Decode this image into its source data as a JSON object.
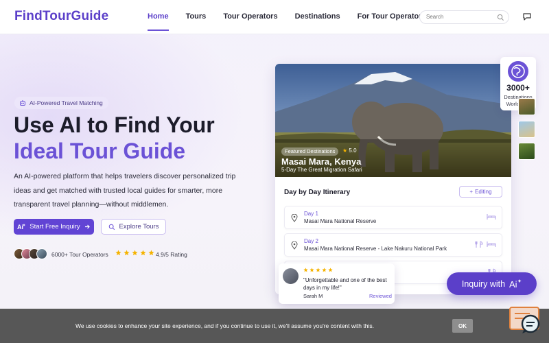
{
  "header": {
    "logo": "FindTourGuide",
    "nav": [
      "Home",
      "Tours",
      "Tour Operators",
      "Destinations",
      "For Tour Operators"
    ],
    "active_nav": "Home",
    "search_placeholder": "Search"
  },
  "hero": {
    "badge": "AI-Powered Travel Matching",
    "title_line1": "Use AI to Find Your",
    "title_line2": "Ideal Tour Guide",
    "description": "An AI-powered platform that helps travelers discover personalized trip ideas and get matched with trusted local guides for smarter, more transparent travel planning—without middlemen.",
    "primary_button": "Start Free Inquiry",
    "secondary_button": "Explore Tours",
    "operators": "6000+ Tour Operators",
    "rating": "4.9/5 Rating"
  },
  "card": {
    "tag": "Featured Destinations",
    "rating": "5.0",
    "title": "Masai Mara, Kenya",
    "subtitle": "5-Day The Great Migration Safari",
    "itinerary_title": "Day by Day Itinerary",
    "editing_label": "Editing",
    "days": [
      {
        "label": "Day 1",
        "desc": "Masai Mara National Reserve"
      },
      {
        "label": "Day 2",
        "desc": "Masai Mara National Reserve - Lake Nakuru National Park"
      }
    ]
  },
  "stats": {
    "number": "3000+",
    "label": "Destinations Worldwide"
  },
  "review": {
    "text": "\"Unforgettable and one of the best days in my life!\"",
    "name": "Sarah M",
    "badge": "Reviewed"
  },
  "inquiry_button": "Inquiry with",
  "cookie": {
    "text": "We use cookies to enhance your site experience, and if you continue to use it, we'll assume you're content with this.",
    "ok": "OK"
  },
  "colors": {
    "brand": "#5b3fc9",
    "accent": "#6b52d6",
    "star": "#f5b301"
  }
}
